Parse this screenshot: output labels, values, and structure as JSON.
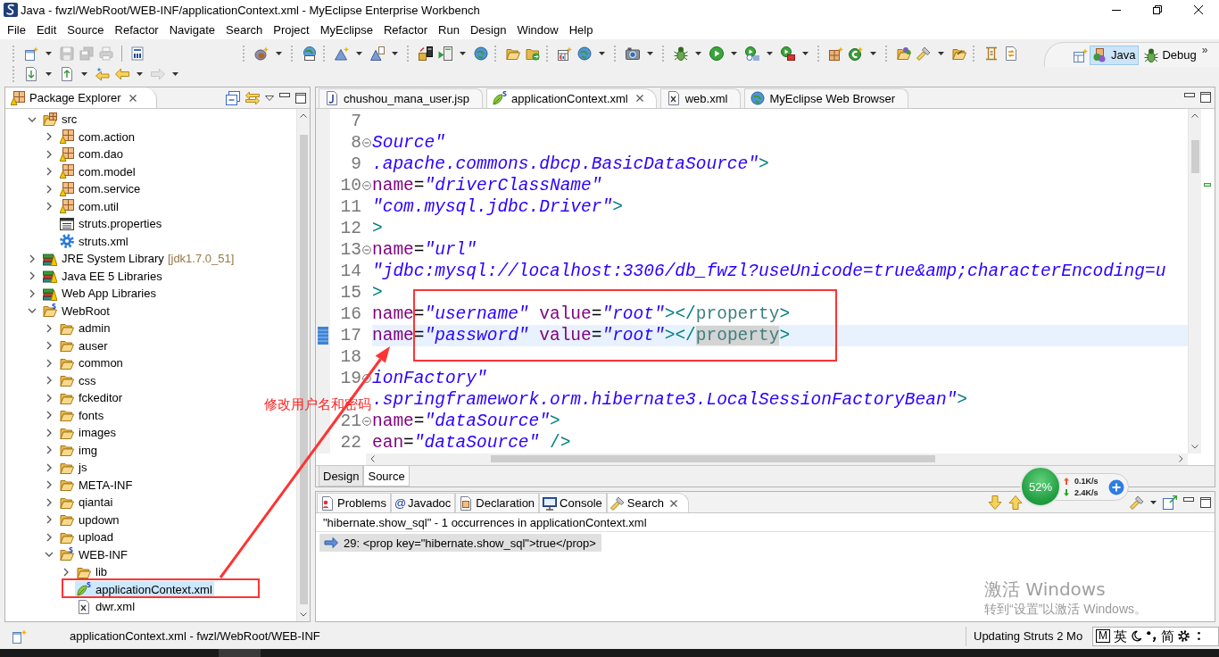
{
  "window": {
    "title": "Java - fwzl/WebRoot/WEB-INF/applicationContext.xml - MyEclipse Enterprise Workbench"
  },
  "menu": [
    "File",
    "Edit",
    "Source",
    "Refactor",
    "Navigate",
    "Search",
    "Project",
    "MyEclipse",
    "Refactor",
    "Run",
    "Design",
    "Window",
    "Help"
  ],
  "toolbar": {
    "rows": [
      [
        {
          "kind": "grip",
          "items": [
            {
              "kind": "new-wizard",
              "dropdown": true,
              "disabled": false
            },
            {
              "kind": "save",
              "dropdown": false,
              "disabled": true
            },
            {
              "kind": "save-all",
              "dropdown": false,
              "disabled": true
            },
            {
              "kind": "print",
              "dropdown": false,
              "disabled": true
            }
          ]
        },
        {
          "kind": "line",
          "items": [
            {
              "kind": "binary",
              "dropdown": false,
              "disabled": false
            }
          ]
        },
        {
          "kind": "grip",
          "items": [
            {
              "kind": "bean-wizard",
              "dropdown": true,
              "disabled": false
            }
          ]
        },
        {
          "kind": "grip",
          "items": [
            {
              "kind": "web-globe",
              "dropdown": false,
              "disabled": false
            }
          ]
        },
        {
          "kind": "grip",
          "items": [
            {
              "kind": "triangle-star",
              "dropdown": true,
              "disabled": false
            },
            {
              "kind": "triangle-page",
              "dropdown": true,
              "disabled": false
            }
          ]
        },
        {
          "kind": "grip",
          "items": [
            {
              "kind": "deploy",
              "dropdown": false,
              "disabled": false
            },
            {
              "kind": "server-run",
              "dropdown": true,
              "disabled": false
            },
            {
              "kind": "globe",
              "dropdown": false,
              "disabled": false
            }
          ]
        },
        {
          "kind": "grip",
          "items": [
            {
              "kind": "open-folder",
              "dropdown": false,
              "disabled": false
            },
            {
              "kind": "export-folder",
              "dropdown": false,
              "disabled": false
            }
          ]
        },
        {
          "kind": "grip",
          "items": [
            {
              "kind": "new-table",
              "dropdown": false,
              "disabled": false
            },
            {
              "kind": "globe-db",
              "dropdown": true,
              "disabled": false
            }
          ]
        },
        {
          "kind": "grip",
          "items": [
            {
              "kind": "camera",
              "dropdown": true,
              "disabled": false
            }
          ]
        },
        {
          "kind": "grip",
          "items": [
            {
              "kind": "debug",
              "dropdown": true,
              "disabled": false
            },
            {
              "kind": "run",
              "dropdown": true,
              "disabled": false
            },
            {
              "kind": "run-history",
              "dropdown": true,
              "disabled": false
            },
            {
              "kind": "run-tools",
              "dropdown": true,
              "disabled": false
            }
          ]
        },
        {
          "kind": "grip",
          "items": [
            {
              "kind": "new-type",
              "dropdown": false,
              "disabled": false
            },
            {
              "kind": "new-class",
              "dropdown": true,
              "disabled": false
            }
          ]
        },
        {
          "kind": "grip",
          "items": [
            {
              "kind": "open-type",
              "dropdown": false,
              "disabled": false
            },
            {
              "kind": "search-tool",
              "dropdown": true,
              "disabled": false
            },
            {
              "kind": "open-brown-folder",
              "dropdown": false,
              "disabled": false
            }
          ]
        },
        {
          "kind": "grip",
          "items": [
            {
              "kind": "annotation",
              "dropdown": false,
              "disabled": false
            },
            {
              "kind": "sync-page",
              "dropdown": false,
              "disabled": false
            }
          ]
        }
      ],
      [
        {
          "kind": "grip",
          "items": [
            {
              "kind": "next-annotation",
              "dropdown": true,
              "disabled": false
            },
            {
              "kind": "prev-annotation",
              "dropdown": true,
              "disabled": false
            },
            {
              "kind": "last-edit",
              "dropdown": false,
              "disabled": false
            },
            {
              "kind": "back",
              "dropdown": true,
              "disabled": false
            },
            {
              "kind": "forward",
              "dropdown": true,
              "disabled": true
            }
          ]
        }
      ]
    ]
  },
  "perspectives": {
    "items": [
      {
        "label": "Java",
        "kind": "java",
        "selected": true
      },
      {
        "label": "Debug",
        "kind": "debug",
        "selected": false
      }
    ],
    "more": "»"
  },
  "package_explorer": {
    "title": "Package Explorer",
    "tree": [
      {
        "label": "src",
        "kind": "source-folder",
        "expanded": true,
        "selected": false,
        "children": [
          {
            "label": "com.action",
            "kind": "package",
            "expanded": false,
            "selected": false
          },
          {
            "label": "com.dao",
            "kind": "package",
            "expanded": false,
            "selected": false
          },
          {
            "label": "com.model",
            "kind": "package",
            "expanded": false,
            "selected": false
          },
          {
            "label": "com.service",
            "kind": "package",
            "expanded": false,
            "selected": false
          },
          {
            "label": "com.util",
            "kind": "package",
            "expanded": false,
            "selected": false
          },
          {
            "label": "struts.properties",
            "kind": "properties",
            "selected": false
          },
          {
            "label": "struts.xml",
            "kind": "struts-xml",
            "selected": false
          }
        ]
      },
      {
        "label": "JRE System Library",
        "decoration": "[jdk1.7.0_51]",
        "kind": "library",
        "expanded": false,
        "selected": false
      },
      {
        "label": "Java EE 5 Libraries",
        "kind": "library",
        "expanded": false,
        "selected": false
      },
      {
        "label": "Web App Libraries",
        "kind": "library",
        "expanded": false,
        "selected": false
      },
      {
        "label": "WebRoot",
        "kind": "web-root",
        "expanded": true,
        "selected": false,
        "children": [
          {
            "label": "admin",
            "kind": "folder",
            "expanded": false,
            "selected": false
          },
          {
            "label": "auser",
            "kind": "folder",
            "expanded": false,
            "selected": false
          },
          {
            "label": "common",
            "kind": "folder",
            "expanded": false,
            "selected": false
          },
          {
            "label": "css",
            "kind": "folder",
            "expanded": false,
            "selected": false
          },
          {
            "label": "fckeditor",
            "kind": "folder",
            "expanded": false,
            "selected": false
          },
          {
            "label": "fonts",
            "kind": "folder",
            "expanded": false,
            "selected": false
          },
          {
            "label": "images",
            "kind": "folder",
            "expanded": false,
            "selected": false
          },
          {
            "label": "img",
            "kind": "folder",
            "expanded": false,
            "selected": false
          },
          {
            "label": "js",
            "kind": "folder",
            "expanded": false,
            "selected": false
          },
          {
            "label": "META-INF",
            "kind": "folder",
            "expanded": false,
            "selected": false
          },
          {
            "label": "qiantai",
            "kind": "folder",
            "expanded": false,
            "selected": false
          },
          {
            "label": "updown",
            "kind": "folder",
            "expanded": false,
            "selected": false
          },
          {
            "label": "upload",
            "kind": "folder",
            "expanded": false,
            "selected": false
          },
          {
            "label": "WEB-INF",
            "kind": "web-root",
            "expanded": true,
            "selected": false,
            "children": [
              {
                "label": "lib",
                "kind": "folder",
                "expanded": false,
                "selected": false
              },
              {
                "label": "applicationContext.xml",
                "kind": "spring-xml",
                "selected": true
              },
              {
                "label": "dwr.xml",
                "kind": "xml",
                "selected": false
              }
            ]
          }
        ]
      }
    ]
  },
  "editor": {
    "tabs": [
      {
        "label": "chushou_mana_user.jsp",
        "kind": "jsp",
        "selected": false
      },
      {
        "label": "applicationContext.xml",
        "kind": "spring-xml",
        "selected": true
      },
      {
        "label": "web.xml",
        "kind": "xml",
        "selected": false
      },
      {
        "label": "MyEclipse Web Browser",
        "kind": "browser",
        "selected": false
      }
    ],
    "lines": [
      {
        "number": "7",
        "fold": false,
        "current": false
      },
      {
        "number": "8",
        "fold": true,
        "current": false,
        "tokens": [
          {
            "kind": "value",
            "text": "Source\""
          }
        ]
      },
      {
        "number": "9",
        "fold": false,
        "current": false,
        "tokens": [
          {
            "kind": "value",
            "text": ".apache.commons.dbcp.BasicDataSource\""
          },
          {
            "kind": "tag",
            "text": ">"
          }
        ]
      },
      {
        "number": "10",
        "fold": true,
        "current": false,
        "tokens": [
          {
            "kind": "attr",
            "text": "name"
          },
          {
            "kind": "eq",
            "text": "="
          },
          {
            "kind": "value",
            "text": "\"driverClassName\""
          }
        ]
      },
      {
        "number": "11",
        "fold": false,
        "current": false,
        "tokens": [
          {
            "kind": "value",
            "text": "\"com.mysql.jdbc.Driver\""
          },
          {
            "kind": "tag",
            "text": ">"
          }
        ]
      },
      {
        "number": "12",
        "fold": false,
        "current": false,
        "tokens": [
          {
            "kind": "tag",
            "text": ">"
          }
        ]
      },
      {
        "number": "13",
        "fold": true,
        "current": false,
        "tokens": [
          {
            "kind": "attr",
            "text": "name"
          },
          {
            "kind": "eq",
            "text": "="
          },
          {
            "kind": "value",
            "text": "\"url\""
          }
        ]
      },
      {
        "number": "14",
        "fold": false,
        "current": false,
        "tokens": [
          {
            "kind": "value",
            "text": "\"jdbc:mysql://localhost:3306/db_fwzl?useUnicode=true&amp;characterEncoding=u"
          }
        ]
      },
      {
        "number": "15",
        "fold": false,
        "current": false,
        "tokens": [
          {
            "kind": "tag",
            "text": ">"
          }
        ]
      },
      {
        "number": "16",
        "fold": false,
        "current": false,
        "tokens": [
          {
            "kind": "attr",
            "text": "name"
          },
          {
            "kind": "eq",
            "text": "="
          },
          {
            "kind": "value",
            "text": "\"username\""
          },
          {
            "kind": "attr",
            "text": " value"
          },
          {
            "kind": "eq",
            "text": "="
          },
          {
            "kind": "value",
            "text": "\"root\""
          },
          {
            "kind": "tag",
            "text": "></"
          },
          {
            "kind": "tagname",
            "text": "property"
          },
          {
            "kind": "tag",
            "text": ">"
          }
        ]
      },
      {
        "number": "17",
        "fold": false,
        "current": true,
        "tokens": [
          {
            "kind": "attr",
            "text": "name"
          },
          {
            "kind": "eq",
            "text": "="
          },
          {
            "kind": "value",
            "text": "\"password\""
          },
          {
            "kind": "attr",
            "text": " value"
          },
          {
            "kind": "eq",
            "text": "="
          },
          {
            "kind": "value",
            "text": "\"root\""
          },
          {
            "kind": "tag",
            "text": "></"
          },
          {
            "kind": "occurrence",
            "text": "property"
          },
          {
            "kind": "tag",
            "text": ">"
          }
        ]
      },
      {
        "number": "18",
        "fold": false,
        "current": false
      },
      {
        "number": "19",
        "fold": true,
        "current": false,
        "tokens": [
          {
            "kind": "value",
            "text": "ionFactory\""
          }
        ]
      },
      {
        "fold": false,
        "current": false,
        "tokens": [
          {
            "kind": "value",
            "text": ".springframework.orm.hibernate3.LocalSessionFactoryBean\""
          },
          {
            "kind": "tag",
            "text": ">"
          }
        ]
      },
      {
        "number": "21",
        "fold": true,
        "current": false,
        "tokens": [
          {
            "kind": "attr",
            "text": "name"
          },
          {
            "kind": "eq",
            "text": "="
          },
          {
            "kind": "value",
            "text": "\"dataSource\""
          },
          {
            "kind": "tag",
            "text": ">"
          }
        ]
      },
      {
        "number": "22",
        "fold": false,
        "current": false,
        "tokens": [
          {
            "kind": "attr",
            "text": "ean"
          },
          {
            "kind": "eq",
            "text": "="
          },
          {
            "kind": "value",
            "text": "\"dataSource\""
          },
          {
            "kind": "tag",
            "text": " />"
          }
        ]
      }
    ],
    "mode_tabs": [
      {
        "label": "Design",
        "selected": false
      },
      {
        "label": "Source",
        "selected": true
      }
    ]
  },
  "bottom_panel": {
    "tabs": [
      {
        "label": "Problems",
        "kind": "problems",
        "selected": false
      },
      {
        "label": "Javadoc",
        "glyph": "@",
        "selected": false
      },
      {
        "label": "Declaration",
        "kind": "declaration",
        "selected": false
      },
      {
        "label": "Console",
        "kind": "console",
        "selected": false
      },
      {
        "label": "Search",
        "kind": "search",
        "selected": true
      }
    ],
    "summary": "\"hibernate.show_sql\" - 1 occurrences in applicationContext.xml",
    "results": [
      {
        "text": "29: <prop key=\"hibernate.show_sql\">true</prop>",
        "selected": true
      }
    ]
  },
  "annotation": {
    "note": "修改用户名和密码"
  },
  "network_widget": {
    "percent": "52%",
    "upload": "0.1K/s",
    "download": "2.4K/s"
  },
  "activation_notice": {
    "title": "激活 Windows",
    "hint": "转到“设置”以激活 Windows。"
  },
  "status_bar": {
    "message": "applicationContext.xml - fwzl/WebRoot/WEB-INF",
    "progress": "Updating Struts 2 Mo"
  },
  "ime_bar": {
    "items": [
      {
        "kind": "boxed",
        "text": "M"
      },
      {
        "kind": "text",
        "text": "英"
      },
      {
        "kind": "moon"
      },
      {
        "kind": "punct"
      },
      {
        "kind": "text",
        "text": "简"
      },
      {
        "kind": "gear"
      },
      {
        "kind": "grip"
      }
    ]
  }
}
